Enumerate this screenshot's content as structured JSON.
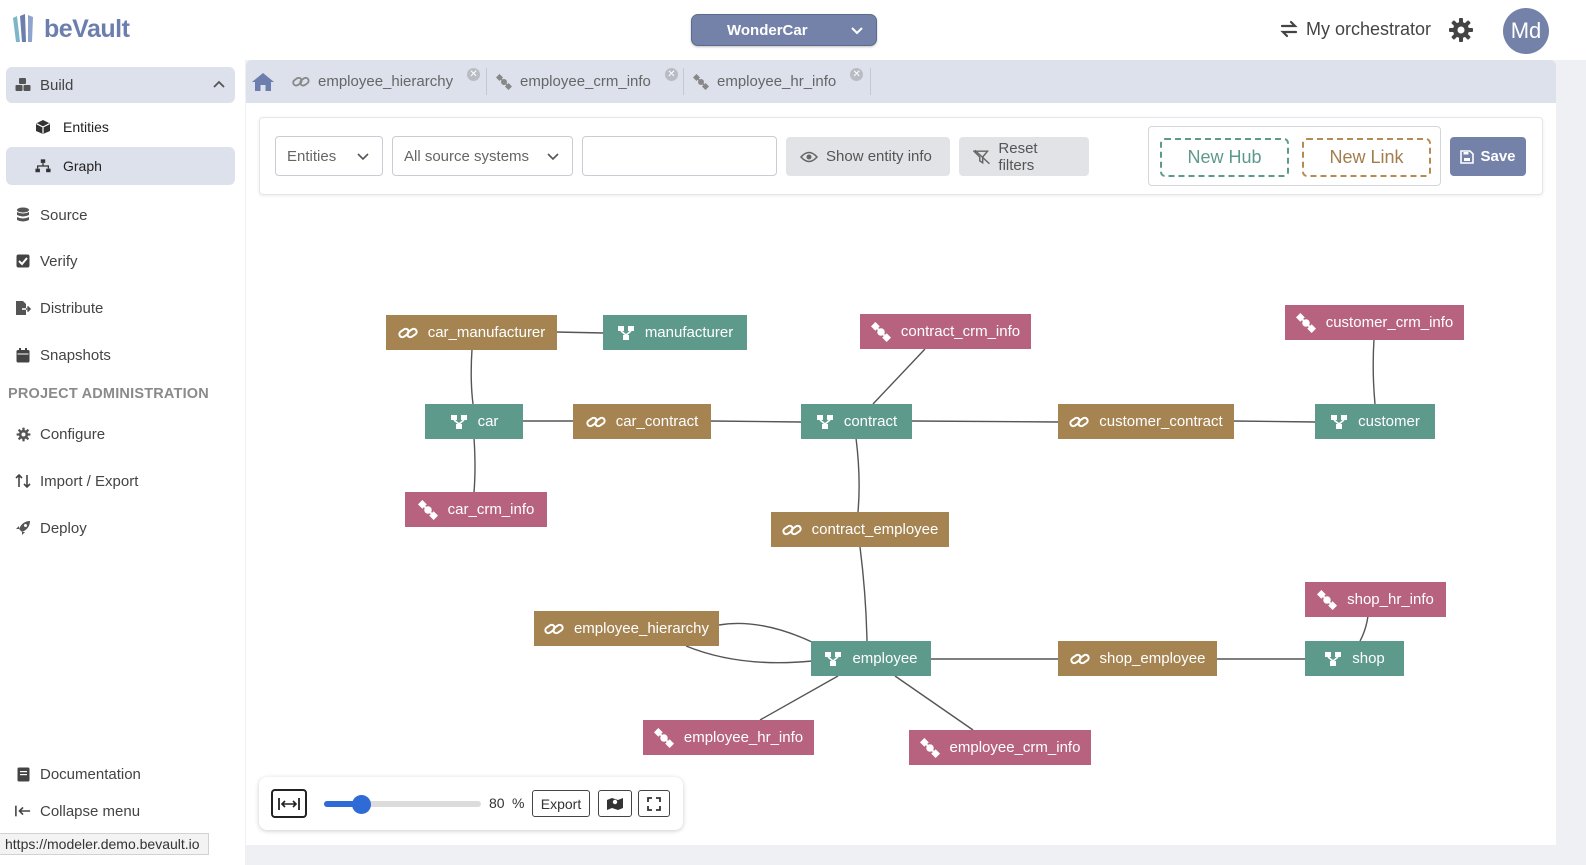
{
  "app": {
    "logo_text": "beVault"
  },
  "header": {
    "project": "WonderCar",
    "orchestrator_label": "My orchestrator",
    "avatar_initials": "Md"
  },
  "sidebar": {
    "build": {
      "label": "Build",
      "sub": [
        {
          "label": "Entities"
        },
        {
          "label": "Graph"
        }
      ]
    },
    "items": [
      {
        "label": "Source"
      },
      {
        "label": "Verify"
      },
      {
        "label": "Distribute"
      },
      {
        "label": "Snapshots"
      }
    ],
    "section_title": "PROJECT ADMINISTRATION",
    "admin_items": [
      {
        "label": "Configure"
      },
      {
        "label": "Import / Export"
      },
      {
        "label": "Deploy"
      }
    ],
    "bottom": [
      {
        "label": "Documentation"
      },
      {
        "label": "Collapse menu"
      }
    ],
    "status_url": "https://modeler.demo.bevault.io"
  },
  "tabs": [
    {
      "label": "employee_hierarchy",
      "type": "link"
    },
    {
      "label": "employee_crm_info",
      "type": "satellite"
    },
    {
      "label": "employee_hr_info",
      "type": "satellite"
    }
  ],
  "toolbar": {
    "entity_filter": "Entities",
    "source_filter": "All source systems",
    "search_value": "",
    "show_entity_info": "Show entity info",
    "reset_filters": "Reset filters",
    "new_hub": "New Hub",
    "new_link": "New Link",
    "save": "Save"
  },
  "graph": {
    "colors": {
      "hub": "#5d9a8c",
      "link": "#a68452",
      "satellite": "#b7637f"
    },
    "nodes": [
      {
        "label": "car_manufacturer",
        "type": "link"
      },
      {
        "label": "manufacturer",
        "type": "hub"
      },
      {
        "label": "contract_crm_info",
        "type": "satellite"
      },
      {
        "label": "customer_crm_info",
        "type": "satellite"
      },
      {
        "label": "car",
        "type": "hub"
      },
      {
        "label": "car_contract",
        "type": "link"
      },
      {
        "label": "contract",
        "type": "hub"
      },
      {
        "label": "customer_contract",
        "type": "link"
      },
      {
        "label": "customer",
        "type": "hub"
      },
      {
        "label": "car_crm_info",
        "type": "satellite"
      },
      {
        "label": "contract_employee",
        "type": "link"
      },
      {
        "label": "shop_hr_info",
        "type": "satellite"
      },
      {
        "label": "employee_hierarchy",
        "type": "link"
      },
      {
        "label": "employee",
        "type": "hub"
      },
      {
        "label": "shop_employee",
        "type": "link"
      },
      {
        "label": "shop",
        "type": "hub"
      },
      {
        "label": "employee_hr_info",
        "type": "satellite"
      },
      {
        "label": "employee_crm_info",
        "type": "satellite"
      }
    ]
  },
  "zoom": {
    "value": "80",
    "unit": "%",
    "level": 0.8,
    "export_label": "Export"
  }
}
